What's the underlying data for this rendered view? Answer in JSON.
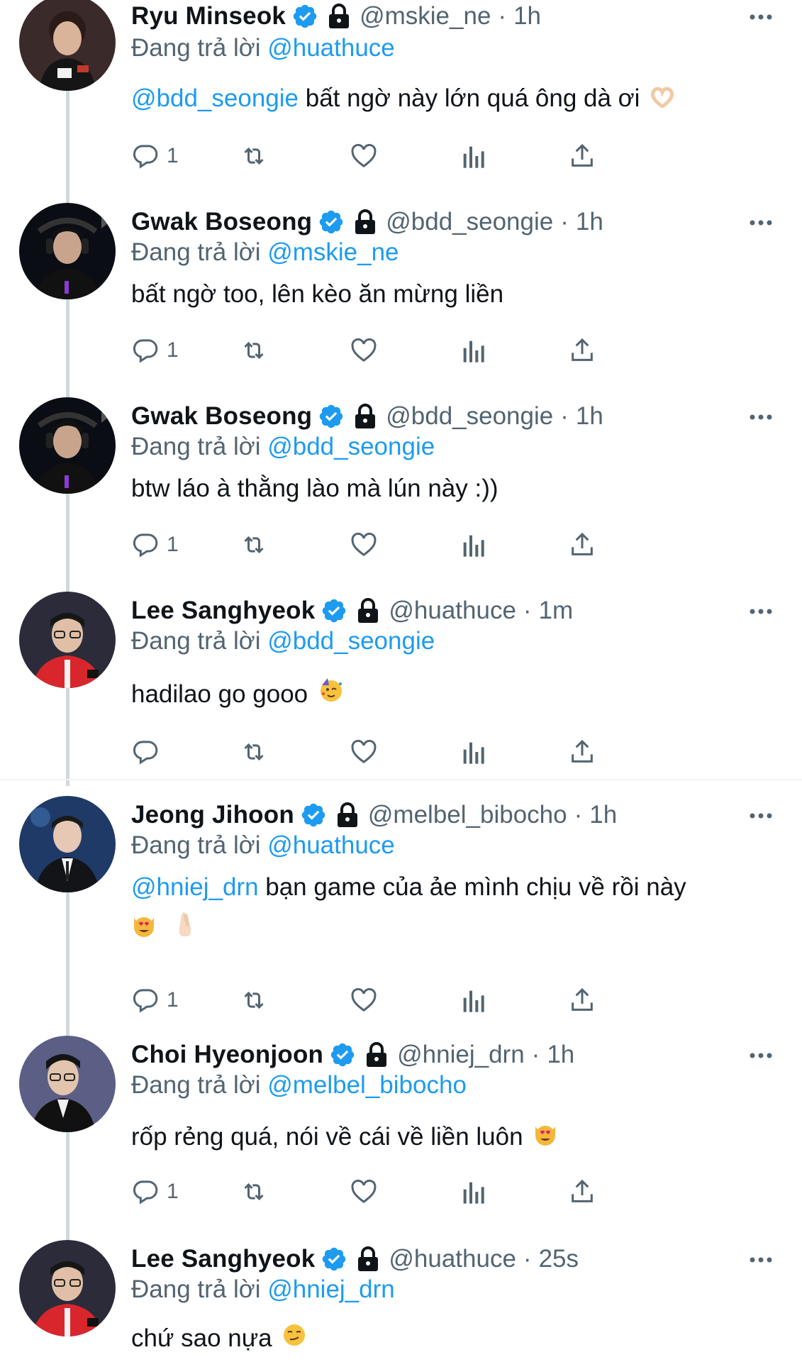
{
  "accent_color": "#1d9bf0",
  "muted_color": "#536471",
  "reply_prefix": "Đang trả lời",
  "tweets": [
    {
      "name": "Ryu Minseok",
      "handle": "@mskie_ne",
      "time": "1h",
      "reply_to": "@huathuce",
      "mention": "@bdd_seongie",
      "text": " bất ngờ này lớn quá ông dà ơi",
      "text2": "",
      "emoji": "heart-hands-emoji",
      "reply_count": "1"
    },
    {
      "name": "Gwak Boseong",
      "handle": "@bdd_seongie",
      "time": "1h",
      "reply_to": "@mskie_ne",
      "mention": "",
      "text": "bất ngờ too, lên kèo ăn mừng liền",
      "text2": "",
      "emoji": "",
      "reply_count": "1"
    },
    {
      "name": "Gwak Boseong",
      "handle": "@bdd_seongie",
      "time": "1h",
      "reply_to": "@bdd_seongie",
      "mention": "",
      "text": "btw láo à thằng lào mà lún này :))",
      "text2": "",
      "emoji": "",
      "reply_count": "1"
    },
    {
      "name": "Lee Sanghyeok",
      "handle": "@huathuce",
      "time": "1m",
      "reply_to": "@bdd_seongie",
      "mention": "",
      "text": "hadilao go gooo",
      "text2": "",
      "emoji": "partying-face-emoji",
      "reply_count": ""
    },
    {
      "name": "Jeong Jihoon",
      "handle": "@melbel_bibocho",
      "time": "1h",
      "reply_to": "@huathuce",
      "mention": "@hniej_drn",
      "text": " bạn game của ảe mình chịu về rồi này",
      "text2": "",
      "emoji": "heart-eyes-cat-emoji, crossed-fingers-emoji",
      "reply_count": "1"
    },
    {
      "name": "Choi Hyeonjoon",
      "handle": "@hniej_drn",
      "time": "1h",
      "reply_to": "@melbel_bibocho",
      "mention": "",
      "text": "rốp rẻng quá, nói về cái về liền luôn",
      "text2": "",
      "emoji": "heart-eyes-cat-emoji",
      "reply_count": "1"
    },
    {
      "name": "Lee Sanghyeok",
      "handle": "@huathuce",
      "time": "25s",
      "reply_to": "@hniej_drn",
      "mention": "",
      "text": "chứ sao nựa",
      "text2": "",
      "emoji": "smirking-face-emoji",
      "reply_count": ""
    }
  ]
}
